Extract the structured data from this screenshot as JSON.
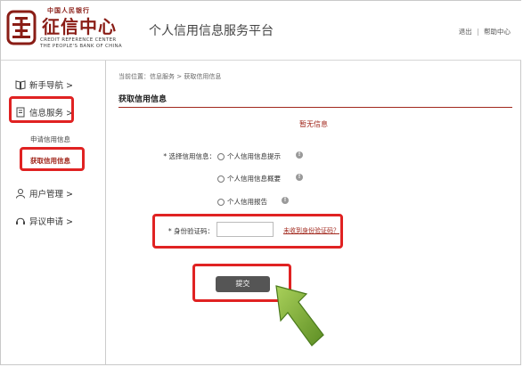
{
  "logo": {
    "cn_top": "中国人民银行",
    "cn_main": "征信中心",
    "en_line1": "CREDIT REFERENCE CENTER",
    "en_line2": "THE PEOPLE'S BANK OF CHINA"
  },
  "header": {
    "title": "个人信用信息服务平台",
    "logout": "退出",
    "separator": "|",
    "help": "帮助中心"
  },
  "sidebar": {
    "items": [
      {
        "label": "新手导航 >",
        "icon": "book-icon"
      },
      {
        "label": "信息服务 >",
        "icon": "document-icon"
      },
      {
        "label": "用户管理 >",
        "icon": "user-icon"
      },
      {
        "label": "异议申请 >",
        "icon": "headset-icon"
      }
    ],
    "sub_items": [
      {
        "label": "申请信用信息"
      },
      {
        "label": "获取信用信息"
      }
    ]
  },
  "main": {
    "breadcrumb": "当前位置：信息服务 > 获取信用信息",
    "section_title": "获取信用信息",
    "empty_notice": "暂无信息",
    "select_label": "* 选择信用信息：",
    "options": [
      {
        "label": "个人信用信息提示"
      },
      {
        "label": "个人信用信息概要"
      },
      {
        "label": "个人信用报告"
      }
    ],
    "code_label": "* 身份验证码：",
    "code_value": "",
    "help_link": "未收到身份验证码？",
    "submit_label": "提交"
  },
  "colors": {
    "brand_red": "#a1271c",
    "highlight_red": "#e02222",
    "arrow_green": "#7fae3a"
  }
}
